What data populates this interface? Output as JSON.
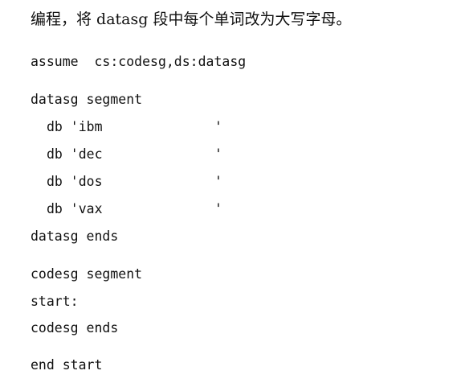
{
  "title": "编程，将 datasg 段中每个单词改为大写字母。",
  "code": {
    "assume": "assume  cs:codesg,ds:datasg",
    "data_begin": "datasg segment",
    "db_lines": [
      {
        "text": "db 'ibm",
        "close": "'"
      },
      {
        "text": "db 'dec",
        "close": "'"
      },
      {
        "text": "db 'dos",
        "close": "'"
      },
      {
        "text": "db 'vax",
        "close": "'"
      }
    ],
    "data_end": "datasg ends",
    "code_begin": "codesg segment",
    "start_label": "start:",
    "code_end": "codesg ends",
    "end_start": "end start"
  }
}
